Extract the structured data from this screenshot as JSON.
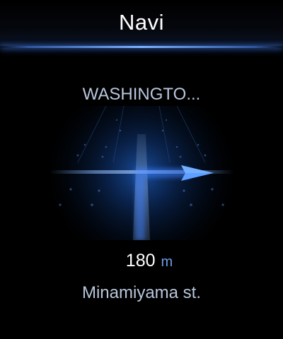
{
  "header": {
    "title": "Navi"
  },
  "guidance": {
    "destination": "WASHINGTO...",
    "maneuver_icon": "turn-right-arrow-icon",
    "distance_value": "180",
    "distance_unit": "m",
    "street": "Minamiyama st."
  },
  "colors": {
    "accent_blue": "#3d7fff",
    "divider_glow": "#7eb2ff",
    "secondary_text": "#b8c6dc",
    "unit_text": "#6f9ee8"
  }
}
